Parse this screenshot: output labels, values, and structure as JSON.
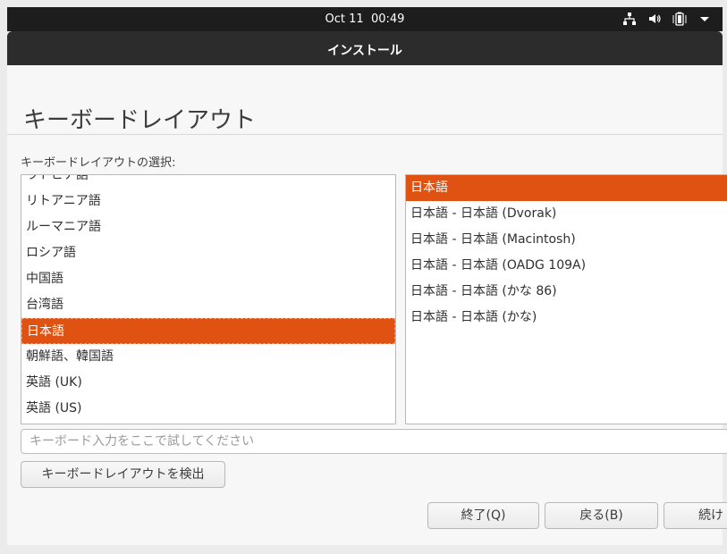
{
  "topbar": {
    "date": "Oct 11",
    "time": "00:49",
    "icons": [
      "network-icon",
      "volume-icon",
      "battery-icon",
      "menu-arrow-icon"
    ]
  },
  "window": {
    "title": "インストール"
  },
  "page": {
    "heading": "キーボードレイアウト",
    "layout_label": "キーボードレイアウトの選択:"
  },
  "layouts": [
    {
      "label": "ラトビア語",
      "selected": false
    },
    {
      "label": "リトアニア語",
      "selected": false
    },
    {
      "label": "ルーマニア語",
      "selected": false
    },
    {
      "label": "ロシア語",
      "selected": false
    },
    {
      "label": "中国語",
      "selected": false
    },
    {
      "label": "台湾語",
      "selected": false
    },
    {
      "label": "日本語",
      "selected": true
    },
    {
      "label": "朝鮮語、韓国語",
      "selected": false
    },
    {
      "label": "英語 (UK)",
      "selected": false
    },
    {
      "label": "英語 (US)",
      "selected": false
    }
  ],
  "variants": [
    {
      "label": "日本語",
      "selected": true
    },
    {
      "label": "日本語 - 日本語 (Dvorak)",
      "selected": false
    },
    {
      "label": "日本語 - 日本語 (Macintosh)",
      "selected": false
    },
    {
      "label": "日本語 - 日本語 (OADG 109A)",
      "selected": false
    },
    {
      "label": "日本語 - 日本語 (かな 86)",
      "selected": false
    },
    {
      "label": "日本語 - 日本語 (かな)",
      "selected": false
    }
  ],
  "test_input": {
    "placeholder": "キーボード入力をここで試してください"
  },
  "buttons": {
    "detect": "キーボードレイアウトを検出",
    "quit": "終了(Q)",
    "back": "戻る(B)",
    "continue": "続け"
  },
  "colors": {
    "accent": "#e05212",
    "topbar": "#1d1d1d",
    "titlebar": "#2c2c2c"
  }
}
